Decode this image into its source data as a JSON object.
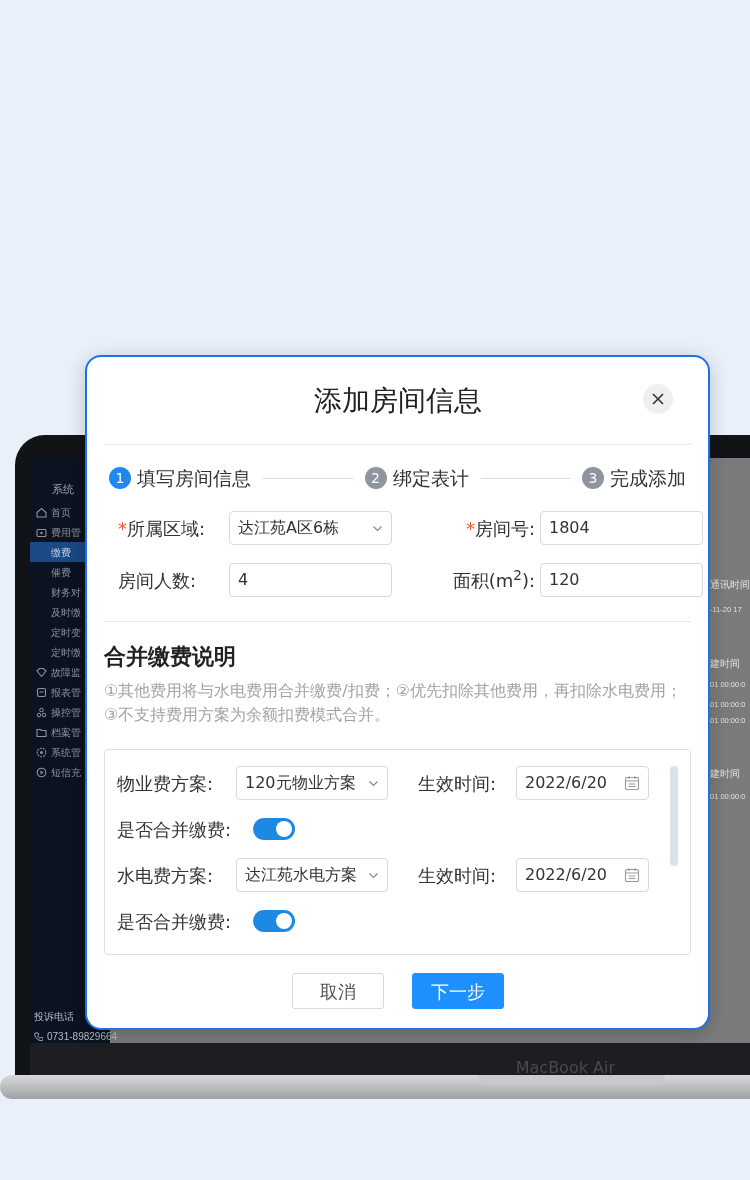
{
  "laptop": {
    "sidebar": {
      "title": "系统",
      "items": [
        {
          "label": "首页",
          "kind": "main",
          "selected": false
        },
        {
          "label": "费用管",
          "kind": "main",
          "selected": false
        },
        {
          "label": "缴费",
          "kind": "sub",
          "selected": true
        },
        {
          "label": "催费",
          "kind": "sub",
          "selected": false
        },
        {
          "label": "财务对",
          "kind": "sub",
          "selected": false
        },
        {
          "label": "及时缴",
          "kind": "sub",
          "selected": false
        },
        {
          "label": "定时变",
          "kind": "sub",
          "selected": false
        },
        {
          "label": "定时缴",
          "kind": "sub",
          "selected": false
        },
        {
          "label": "故障监",
          "kind": "main",
          "selected": false
        },
        {
          "label": "报表管",
          "kind": "main",
          "selected": false
        },
        {
          "label": "操控管",
          "kind": "main",
          "selected": false
        },
        {
          "label": "档案管",
          "kind": "main",
          "selected": false
        },
        {
          "label": "系统管",
          "kind": "main",
          "selected": false
        },
        {
          "label": "短信充",
          "kind": "main",
          "selected": false
        }
      ],
      "footer_label": "投诉电话",
      "phone": "0731-89829664"
    },
    "table_fragments": [
      "通讯时间",
      "-11-20 17",
      "建时间",
      "01 00:00:0",
      "01 00:00:0",
      "01 00:00:0",
      "建时间",
      "01 00:00:0"
    ],
    "brand": "MacBook Air"
  },
  "dialog": {
    "title": "添加房间信息",
    "steps": [
      {
        "number": "1",
        "label": "填写房间信息",
        "selected": true
      },
      {
        "number": "2",
        "label": "绑定表计",
        "selected": false
      },
      {
        "number": "3",
        "label": "完成添加",
        "selected": false
      }
    ],
    "fields": [
      {
        "marker": "*",
        "label": "所属区域:",
        "kind": "select",
        "value": "达江苑A区6栋"
      },
      {
        "marker": "*",
        "label": "房间号:",
        "kind": "input",
        "value": "1804"
      },
      {
        "label": "房间人数:",
        "kind": "input",
        "value": "4"
      },
      {
        "label": "面积(m$^{2}$):",
        "kind": "input",
        "value": "120"
      }
    ],
    "section": {
      "title": "合并缴费说明",
      "note": "①其他费用将与水电费用合并缴费/扣费；②优先扣除其他费用，再扣除水电费用；③不支持费用方案为余额扣费模式合并。"
    },
    "plans": [
      {
        "label": "物业费方案:",
        "value": "120元物业方案",
        "date_label": "生效时间:",
        "date": "2022/6/20",
        "merge_label": "是否合并缴费:",
        "merge_on": true
      },
      {
        "label": "水电费方案:",
        "value": "达江苑水电方案",
        "date_label": "生效时间:",
        "date": "2022/6/20",
        "merge_label": "是否合并缴费:",
        "merge_on": true
      }
    ],
    "buttons": [
      {
        "label": "取消",
        "kind": "secondary"
      },
      {
        "label": "下一步",
        "kind": "primary"
      }
    ]
  }
}
